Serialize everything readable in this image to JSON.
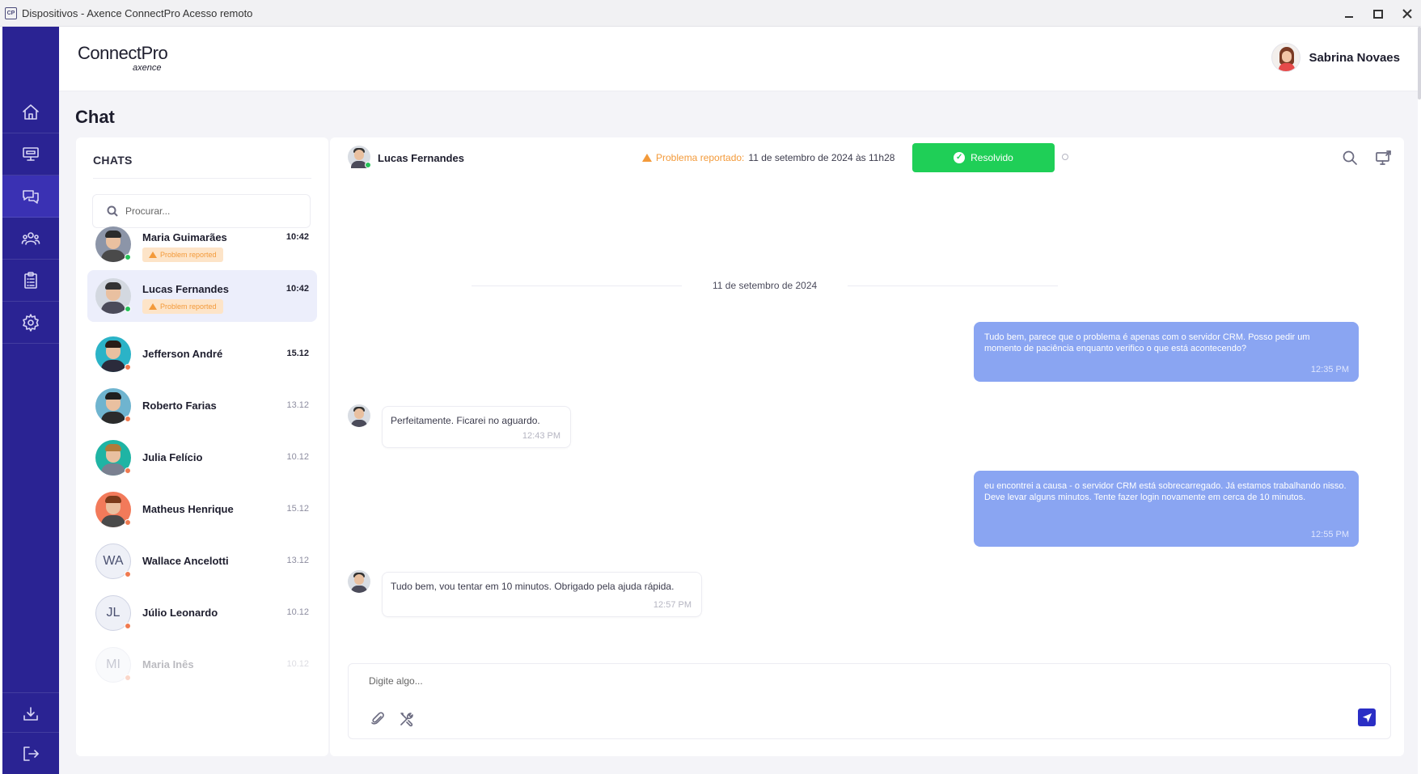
{
  "window": {
    "icon_text": "CP",
    "title": "Dispositivos - Axence ConnectPro Acesso remoto",
    "controls": [
      "minimize-icon",
      "maximize-icon",
      "close-icon"
    ]
  },
  "nav": {
    "items": [
      {
        "icon": "home-icon",
        "active": false
      },
      {
        "icon": "devices-icon",
        "active": false
      },
      {
        "icon": "chat-icon",
        "active": true
      },
      {
        "icon": "users-icon",
        "active": false
      },
      {
        "icon": "clipboard-icon",
        "active": false
      },
      {
        "icon": "settings-icon",
        "active": false
      }
    ],
    "bottom_items": [
      {
        "icon": "download-icon"
      },
      {
        "icon": "logout-icon"
      }
    ]
  },
  "header": {
    "logo_main": "ConnectPro",
    "logo_sub": "axence",
    "user_name": "Sabrina Novaes"
  },
  "page": {
    "title": "Chat"
  },
  "chats": {
    "heading": "CHATS",
    "search_placeholder": "Procurar...",
    "items": [
      {
        "name": "Maria Guimarães",
        "time": "10:42",
        "time_bold": true,
        "badge": "Problem reported",
        "status_color": "#27c25a",
        "avatar_bg": "#8c95a8",
        "hair": "#2b2b2b",
        "body": "#4a4a4a",
        "active": false
      },
      {
        "name": "Lucas Fernandes",
        "time": "10:42",
        "time_bold": true,
        "badge": "Problem reported",
        "status_color": "#27c25a",
        "avatar_bg": "#d3d8e0",
        "hair": "#333333",
        "body": "#4b4b5a",
        "active": true
      },
      {
        "name": "Jefferson André",
        "time": "15.12",
        "time_bold": true,
        "badge": "",
        "status_color": "#f07a50",
        "avatar_bg": "#2bb3c7",
        "hair": "#2a1d17",
        "body": "#2b2b3b",
        "active": false
      },
      {
        "name": "Roberto Farias",
        "time": "13.12",
        "time_bold": false,
        "badge": "",
        "status_color": "#f07a50",
        "avatar_bg": "#6fb4cf",
        "hair": "#1f1f1f",
        "body": "#2b2b2b",
        "active": false
      },
      {
        "name": "Julia Felício",
        "time": "10.12",
        "time_bold": false,
        "badge": "",
        "status_color": "#f07a50",
        "avatar_bg": "#1fb4a4",
        "hair": "#b07a3a",
        "body": "#7a8090",
        "active": false
      },
      {
        "name": "Matheus Henrique",
        "time": "15.12",
        "time_bold": false,
        "badge": "",
        "status_color": "#f07a50",
        "avatar_bg": "#f27a5a",
        "hair": "#7a3a1a",
        "body": "#4a4a4a",
        "active": false
      },
      {
        "name": "Wallace Ancelotti",
        "time": "13.12",
        "time_bold": false,
        "badge": "",
        "status_color": "#f07a50",
        "initials": "WA",
        "active": false
      },
      {
        "name": "Júlio Leonardo",
        "time": "10.12",
        "time_bold": false,
        "badge": "",
        "status_color": "#f07a50",
        "initials": "JL",
        "active": false
      },
      {
        "name": "Maria Inês",
        "time": "10.12",
        "time_bold": false,
        "badge": "",
        "status_color": "#f07a50",
        "initials": "MI",
        "active": false,
        "faded": true
      }
    ]
  },
  "conversation": {
    "contact_name": "Lucas Fernandes",
    "problem_label": "Problema reportado:",
    "problem_date": "11 de setembro de 2024 às 11h28",
    "resolved_label": "Resolvido",
    "date_separator": "11 de setembro de 2024",
    "messages": [
      {
        "direction": "out",
        "text": "Tudo bem, parece que o problema é apenas com o servidor CRM. Posso pedir um momento de paciência enquanto verifico o que está acontecendo?",
        "time": "12:35 PM"
      },
      {
        "direction": "in",
        "text": "Perfeitamente. Ficarei no aguardo.",
        "time": "12:43 PM"
      },
      {
        "direction": "out",
        "text": "eu encontrei a causa - o servidor CRM está sobrecarregado. Já estamos trabalhando nisso. Deve levar alguns minutos. Tente fazer login novamente em cerca de 10 minutos.",
        "time": "12:55 PM"
      },
      {
        "direction": "in",
        "text": "Tudo bem, vou tentar em 10 minutos. Obrigado pela ajuda rápida.",
        "time": "12:57 PM"
      }
    ],
    "composer_placeholder": "Digite algo..."
  },
  "colors": {
    "nav_bg": "#2a2393",
    "accent": "#2a2ec5",
    "resolved_green": "#1fcf57",
    "warning_orange": "#f39a3a",
    "outgoing_bubble": "#8aa5f2"
  }
}
